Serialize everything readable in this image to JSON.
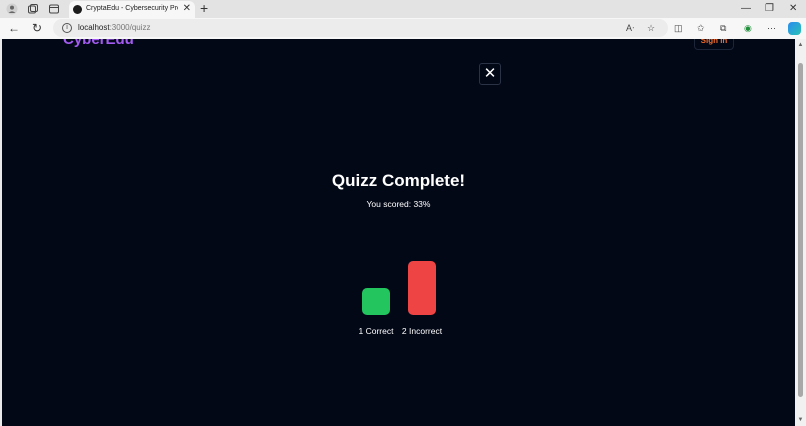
{
  "browser": {
    "tab_title": "CryptaEdu - Cybersecurity Preven",
    "url_host": "localhost",
    "url_path": ":3000/quizz"
  },
  "site": {
    "logo": "CyberEdu",
    "signin_label": "Sign In"
  },
  "modal": {
    "close_glyph": "✕",
    "title": "Quizz Complete!",
    "score_text": "You scored: 33%"
  },
  "results": {
    "max": 2,
    "bars": [
      {
        "label": "1 Correct",
        "value": 1,
        "color": "#22c55e"
      },
      {
        "label": "2 Incorrect",
        "value": 2,
        "color": "#ef4444"
      }
    ]
  }
}
